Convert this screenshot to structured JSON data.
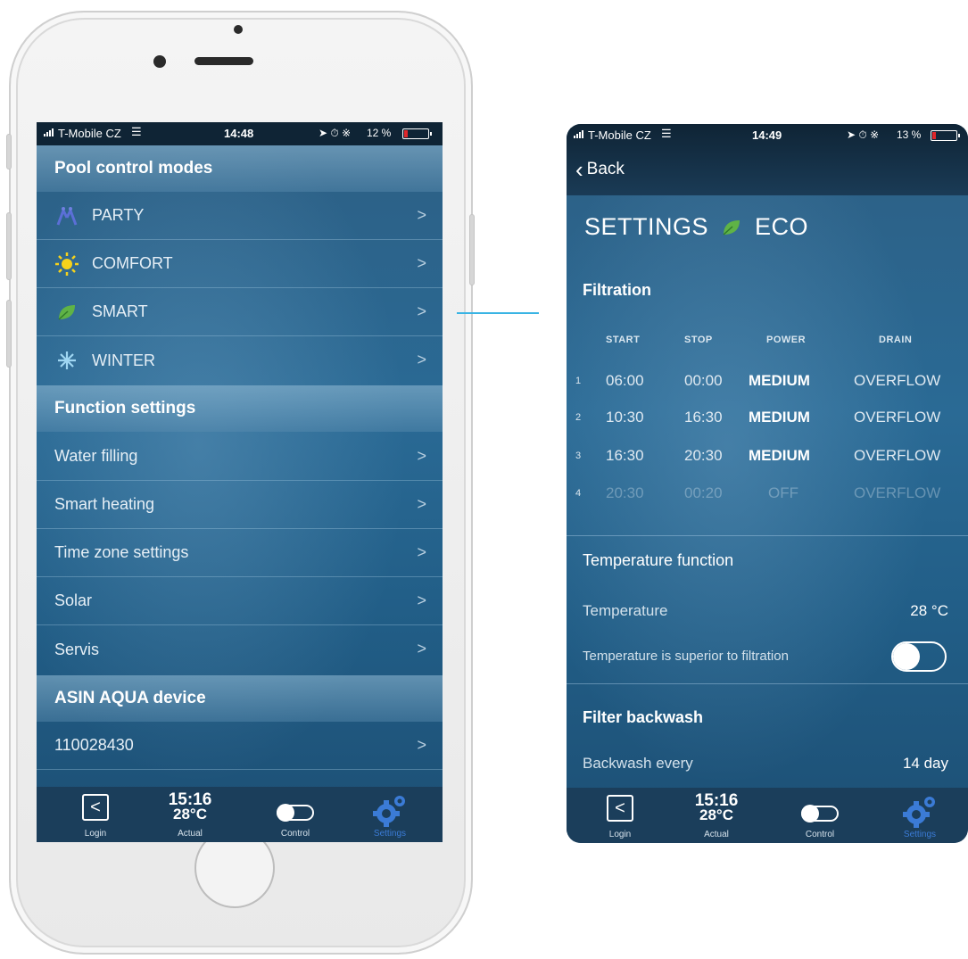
{
  "left_phone": {
    "status": {
      "carrier": "T-Mobile CZ",
      "time": "14:48",
      "battery": "12 %"
    },
    "sections": {
      "modes_title": "Pool control modes",
      "modes": [
        {
          "label": "PARTY",
          "icon": "party-icon"
        },
        {
          "label": "COMFORT",
          "icon": "sun-icon"
        },
        {
          "label": "SMART",
          "icon": "leaf-icon"
        },
        {
          "label": "WINTER",
          "icon": "snowflake-icon"
        }
      ],
      "functions_title": "Function settings",
      "functions": [
        "Water filling",
        "Smart heating",
        "Time zone settings",
        "Solar",
        "Servis"
      ],
      "device_title": "ASIN AQUA device",
      "device_id": "110028430"
    }
  },
  "tabbar": {
    "login": "Login",
    "time": "15:16",
    "temp": "28°C",
    "actual": "Actual",
    "control": "Control",
    "settings": "Settings"
  },
  "right_phone": {
    "status": {
      "carrier": "T-Mobile CZ",
      "time": "14:49",
      "battery": "13 %"
    },
    "back": "Back",
    "title": "SETTINGS",
    "mode": "ECO",
    "filtration_title": "Filtration",
    "filtration_headers": {
      "start": "START",
      "stop": "STOP",
      "power": "POWER",
      "drain": "DRAIN"
    },
    "filtration_rows": [
      {
        "idx": "1",
        "start": "06:00",
        "stop": "00:00",
        "power": "MEDIUM",
        "drain": "OVERFLOW"
      },
      {
        "idx": "2",
        "start": "10:30",
        "stop": "16:30",
        "power": "MEDIUM",
        "drain": "OVERFLOW"
      },
      {
        "idx": "3",
        "start": "16:30",
        "stop": "20:30",
        "power": "MEDIUM",
        "drain": "OVERFLOW"
      },
      {
        "idx": "4",
        "start": "20:30",
        "stop": "00:20",
        "power": "OFF",
        "drain": "OVERFLOW"
      }
    ],
    "temperature_title": "Temperature function",
    "temperature_label": "Temperature",
    "temperature_value": "28 °C",
    "superior_label": "Temperature is superior to filtration",
    "backwash_title": "Filter backwash",
    "backwash_label": "Backwash every",
    "backwash_value": "14 day"
  },
  "colors": {
    "accent_line": "#39b4e4",
    "settings_tab": "#3b7bd6",
    "leaf": "#5fb346",
    "sun": "#f6d21b"
  }
}
